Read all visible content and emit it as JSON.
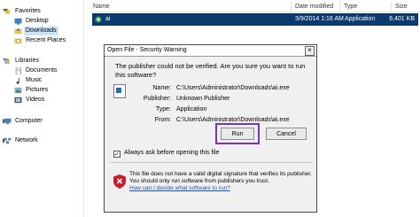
{
  "nav": {
    "items": [
      {
        "label": "Favorites",
        "icon": "star-icon",
        "selected": false
      },
      {
        "label": "Desktop",
        "icon": "desktop-icon",
        "selected": false
      },
      {
        "label": "Downloads",
        "icon": "downloads-folder-icon",
        "selected": true
      },
      {
        "label": "Recent Places",
        "icon": "recent-places-icon",
        "selected": false
      },
      {
        "label": "Libraries",
        "icon": "libraries-icon",
        "selected": false
      },
      {
        "label": "Documents",
        "icon": "documents-icon",
        "selected": false
      },
      {
        "label": "Music",
        "icon": "music-icon",
        "selected": false
      },
      {
        "label": "Pictures",
        "icon": "pictures-icon",
        "selected": false
      },
      {
        "label": "Videos",
        "icon": "videos-icon",
        "selected": false
      },
      {
        "label": "Computer",
        "icon": "computer-icon",
        "selected": false
      },
      {
        "label": "Network",
        "icon": "network-icon",
        "selected": false
      }
    ]
  },
  "columns": {
    "name": "Name",
    "date": "Date modified",
    "type": "Type",
    "size": "Size"
  },
  "file": {
    "name": "ai",
    "date": "3/9/2014 1:16 AM",
    "type": "Application",
    "size": "6,401 KB"
  },
  "dialog": {
    "title": "Open File - Security Warning",
    "warning": "The publisher could not be verified.  Are you sure you want to run this software?",
    "fields": {
      "name_label": "Name:",
      "name_value": "C:\\Users\\Administrator\\Downloads\\ai.exe",
      "publisher_label": "Publisher:",
      "publisher_value": "Unknown Publisher",
      "type_label": "Type:",
      "type_value": "Application",
      "from_label": "From:",
      "from_value": "C:\\Users\\Administrator\\Downloads\\ai.exe"
    },
    "run_label": "Run",
    "cancel_label": "Cancel",
    "checkbox_label": "Always ask before opening this file",
    "checkbox_checked": true,
    "footer": "This file does not have a valid digital signature that verifies its publisher.  You should only run software from publishers you trust.",
    "footer_link": "How can I decide what software to run?"
  },
  "colors": {
    "selected_row": "#0b3a6e",
    "highlight": "#7a2fd0",
    "link": "#1a55b3"
  }
}
